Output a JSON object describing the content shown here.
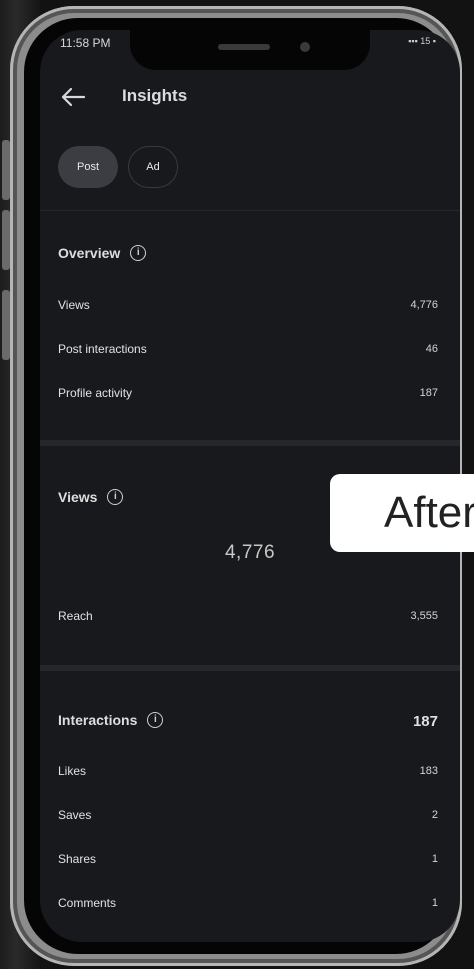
{
  "status_bar": {
    "time": "11:58 PM",
    "icons": "▪▪▪ 15 ▪"
  },
  "header": {
    "title": "Insights"
  },
  "tabs": [
    {
      "label": "Post",
      "selected": true
    },
    {
      "label": "Ad",
      "selected": false
    }
  ],
  "overview": {
    "title": "Overview",
    "rows": [
      {
        "label": "Views",
        "value": "4,776"
      },
      {
        "label": "Post interactions",
        "value": "46"
      },
      {
        "label": "Profile activity",
        "value": "187"
      }
    ]
  },
  "views": {
    "title": "Views",
    "total": "4,776",
    "rows": [
      {
        "label": "Reach",
        "value": "3,555"
      }
    ]
  },
  "interactions": {
    "title": "Interactions",
    "total": "187",
    "rows": [
      {
        "label": "Likes",
        "value": "183"
      },
      {
        "label": "Saves",
        "value": "2"
      },
      {
        "label": "Shares",
        "value": "1"
      },
      {
        "label": "Comments",
        "value": "1"
      }
    ]
  },
  "overlay_label": "After",
  "colors": {
    "background": "#17191c",
    "selected_tab": "#3b3d42",
    "divider": "#25272b"
  }
}
